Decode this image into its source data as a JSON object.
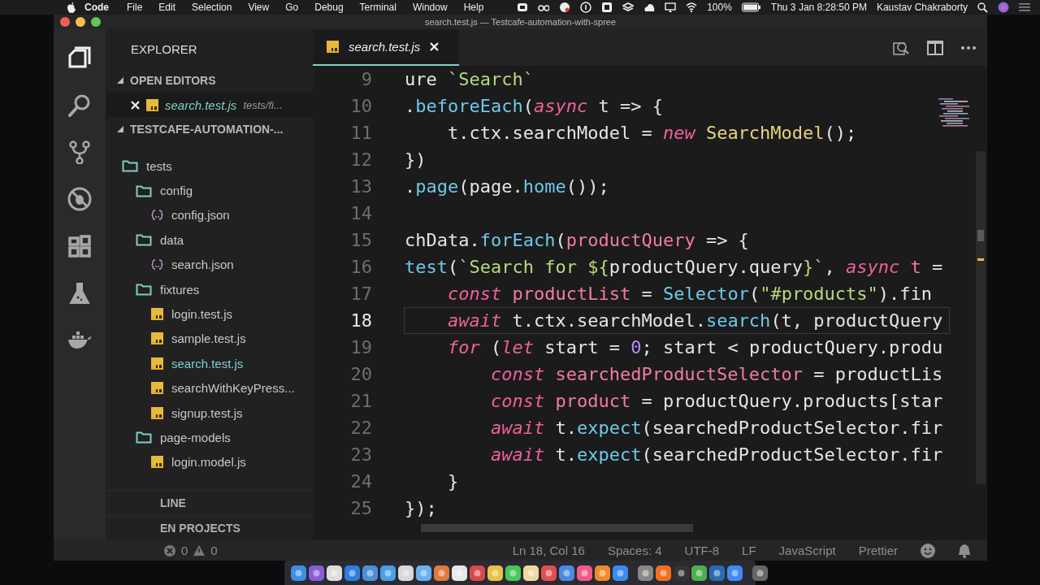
{
  "menu_bar": {
    "app": "Code",
    "items": [
      "File",
      "Edit",
      "Selection",
      "View",
      "Go",
      "Debug",
      "Terminal",
      "Window",
      "Help"
    ],
    "battery": "100%",
    "clock": "Thu 3 Jan 8:28:50 PM",
    "user": "Kaustav Chakraborty"
  },
  "window": {
    "title": "search.test.js — Testcafe-automation-with-spree"
  },
  "activity_bar": [
    {
      "kind": "files",
      "selected": true
    },
    {
      "kind": "search",
      "selected": false
    },
    {
      "kind": "source-control",
      "selected": false
    },
    {
      "kind": "debug",
      "selected": false
    },
    {
      "kind": "extensions",
      "selected": false
    },
    {
      "kind": "flask",
      "selected": false
    },
    {
      "kind": "docker",
      "selected": false
    }
  ],
  "sidebar": {
    "title": "EXPLORER",
    "open_editors": {
      "label": "OPEN EDITORS",
      "expanded": true,
      "items": [
        {
          "name": "search.test.js",
          "path": "tests/fi..."
        }
      ]
    },
    "project": {
      "label": "TESTCAFE-AUTOMATION-...",
      "expanded": true,
      "tree": [
        {
          "name": "tests",
          "kind": "folder",
          "selected": false,
          "children": [
            {
              "name": "config",
              "kind": "folder",
              "selected": false,
              "children": [
                {
                  "name": "config.json",
                  "kind": "json",
                  "selected": false
                }
              ]
            },
            {
              "name": "data",
              "kind": "folder",
              "selected": false,
              "children": [
                {
                  "name": "search.json",
                  "kind": "json",
                  "selected": false
                }
              ]
            },
            {
              "name": "fixtures",
              "kind": "folder",
              "selected": false,
              "children": [
                {
                  "name": "login.test.js",
                  "kind": "js",
                  "selected": false
                },
                {
                  "name": "sample.test.js",
                  "kind": "js",
                  "selected": false
                },
                {
                  "name": "search.test.js",
                  "kind": "js",
                  "selected": true
                },
                {
                  "name": "searchWithKeyPress...",
                  "kind": "js",
                  "selected": false
                },
                {
                  "name": "signup.test.js",
                  "kind": "js",
                  "selected": false
                }
              ]
            },
            {
              "name": "page-models",
              "kind": "folder",
              "selected": false,
              "children": [
                {
                  "name": "login.model.js",
                  "kind": "js",
                  "selected": false
                }
              ]
            }
          ]
        }
      ]
    },
    "collapsed_sections": [
      "LINE",
      "EN PROJECTS"
    ]
  },
  "editor": {
    "tab": {
      "name": "search.test.js"
    },
    "lines": [
      {
        "number": "9",
        "current": false,
        "tokens": [
          {
            "text": "ure ",
            "kind": "plain"
          },
          {
            "text": "`Search`",
            "kind": "str"
          }
        ]
      },
      {
        "number": "10",
        "current": false,
        "tokens": [
          {
            "text": ".",
            "kind": "plain"
          },
          {
            "text": "beforeEach",
            "kind": "fn"
          },
          {
            "text": "(",
            "kind": "plain"
          },
          {
            "text": "async",
            "kind": "kw"
          },
          {
            "text": " t => {",
            "kind": "plain"
          }
        ]
      },
      {
        "number": "11",
        "current": false,
        "tokens": [
          {
            "text": "    t.ctx.searchModel = ",
            "kind": "plain"
          },
          {
            "text": "new",
            "kind": "kw"
          },
          {
            "text": " SearchModel",
            "kind": "cls"
          },
          {
            "text": "();",
            "kind": "plain"
          }
        ]
      },
      {
        "number": "12",
        "current": false,
        "tokens": [
          {
            "text": "})",
            "kind": "plain"
          }
        ]
      },
      {
        "number": "13",
        "current": false,
        "tokens": [
          {
            "text": ".",
            "kind": "plain"
          },
          {
            "text": "page",
            "kind": "fn"
          },
          {
            "text": "(page.",
            "kind": "plain"
          },
          {
            "text": "home",
            "kind": "fn"
          },
          {
            "text": "());",
            "kind": "plain"
          }
        ]
      },
      {
        "number": "14",
        "current": false
      },
      {
        "number": "15",
        "current": false,
        "tokens": [
          {
            "text": "chData.",
            "kind": "plain"
          },
          {
            "text": "forEach",
            "kind": "fn"
          },
          {
            "text": "(",
            "kind": "plain"
          },
          {
            "text": "productQuery",
            "kind": "param"
          },
          {
            "text": " => {",
            "kind": "plain"
          }
        ]
      },
      {
        "number": "16",
        "current": false,
        "tokens": [
          {
            "text": "test",
            "kind": "fn"
          },
          {
            "text": "(",
            "kind": "plain"
          },
          {
            "text": "`Search for ${",
            "kind": "str"
          },
          {
            "text": "productQuery.query",
            "kind": "plain"
          },
          {
            "text": "}`",
            "kind": "str"
          },
          {
            "text": ", ",
            "kind": "plain"
          },
          {
            "text": "async",
            "kind": "kw"
          },
          {
            "text": " t",
            "kind": "param"
          },
          {
            "text": " =",
            "kind": "plain"
          }
        ]
      },
      {
        "number": "17",
        "current": false,
        "tokens": [
          {
            "text": "    const",
            "kind": "kw"
          },
          {
            "text": " productList",
            "kind": "param"
          },
          {
            "text": " = ",
            "kind": "plain"
          },
          {
            "text": "Selector",
            "kind": "fn"
          },
          {
            "text": "(",
            "kind": "plain"
          },
          {
            "text": "\"#products\"",
            "kind": "str"
          },
          {
            "text": ").fin",
            "kind": "plain"
          }
        ]
      },
      {
        "number": "18",
        "current": true,
        "tokens": [
          {
            "text": "    await",
            "kind": "kw"
          },
          {
            "text": " t.ctx.searchModel.",
            "kind": "plain"
          },
          {
            "text": "search",
            "kind": "fn"
          },
          {
            "text": "(t, productQuery",
            "kind": "plain"
          }
        ]
      },
      {
        "number": "19",
        "current": false,
        "tokens": [
          {
            "text": "    for",
            "kind": "kw"
          },
          {
            "text": " (",
            "kind": "plain"
          },
          {
            "text": "let",
            "kind": "kw"
          },
          {
            "text": " start = ",
            "kind": "plain"
          },
          {
            "text": "0",
            "kind": "num"
          },
          {
            "text": "; start < productQuery.produ",
            "kind": "plain"
          }
        ]
      },
      {
        "number": "20",
        "current": false,
        "tokens": [
          {
            "text": "        const",
            "kind": "kw"
          },
          {
            "text": " searchedProductSelector",
            "kind": "param"
          },
          {
            "text": " = productLis",
            "kind": "plain"
          }
        ]
      },
      {
        "number": "21",
        "current": false,
        "tokens": [
          {
            "text": "        const",
            "kind": "kw"
          },
          {
            "text": " product",
            "kind": "param"
          },
          {
            "text": " = productQuery.products[star",
            "kind": "plain"
          }
        ]
      },
      {
        "number": "22",
        "current": false,
        "tokens": [
          {
            "text": "        await",
            "kind": "kw"
          },
          {
            "text": " t.",
            "kind": "plain"
          },
          {
            "text": "expect",
            "kind": "fn"
          },
          {
            "text": "(searchedProductSelector.fir",
            "kind": "plain"
          }
        ]
      },
      {
        "number": "23",
        "current": false,
        "tokens": [
          {
            "text": "        await",
            "kind": "kw"
          },
          {
            "text": " t.",
            "kind": "plain"
          },
          {
            "text": "expect",
            "kind": "fn"
          },
          {
            "text": "(searchedProductSelector.fir",
            "kind": "plain"
          }
        ]
      },
      {
        "number": "24",
        "current": false,
        "tokens": [
          {
            "text": "    }",
            "kind": "plain"
          }
        ]
      },
      {
        "number": "25",
        "current": false,
        "tokens": [
          {
            "text": "});",
            "kind": "plain"
          }
        ]
      }
    ]
  },
  "status_bar": {
    "errors": "0",
    "warnings": "0",
    "items": [
      "Ln 18, Col 16",
      "Spaces: 4",
      "UTF-8",
      "LF",
      "JavaScript",
      "Prettier"
    ]
  },
  "dock": {
    "apps": [
      {
        "color": "#3d8fe0"
      },
      {
        "color": "#8a5cd6"
      },
      {
        "color": "#dddddd"
      },
      {
        "color": "#2f7de1"
      },
      {
        "color": "#4a90d9"
      },
      {
        "color": "#4aa0e8"
      },
      {
        "color": "#d8d8d8"
      },
      {
        "color": "#6ab0f0"
      },
      {
        "color": "#e07a3c"
      },
      {
        "color": "#e8e8e8"
      },
      {
        "color": "#d64a4a"
      },
      {
        "color": "#e8c14a"
      },
      {
        "color": "#48c75a"
      },
      {
        "color": "#f0d9a0"
      },
      {
        "color": "#e05050"
      },
      {
        "color": "#4a8ae0"
      },
      {
        "color": "#f05a8a"
      },
      {
        "color": "#f08a2a"
      },
      {
        "color": "#3a8af0"
      },
      {
        "color": "#888888"
      },
      {
        "color": "#f07020"
      },
      {
        "color": "#333333"
      },
      {
        "color": "#4caf50"
      },
      {
        "color": "#2a6ab0"
      },
      {
        "color": "#3d8af7"
      },
      {
        "color": "#666666"
      }
    ]
  }
}
